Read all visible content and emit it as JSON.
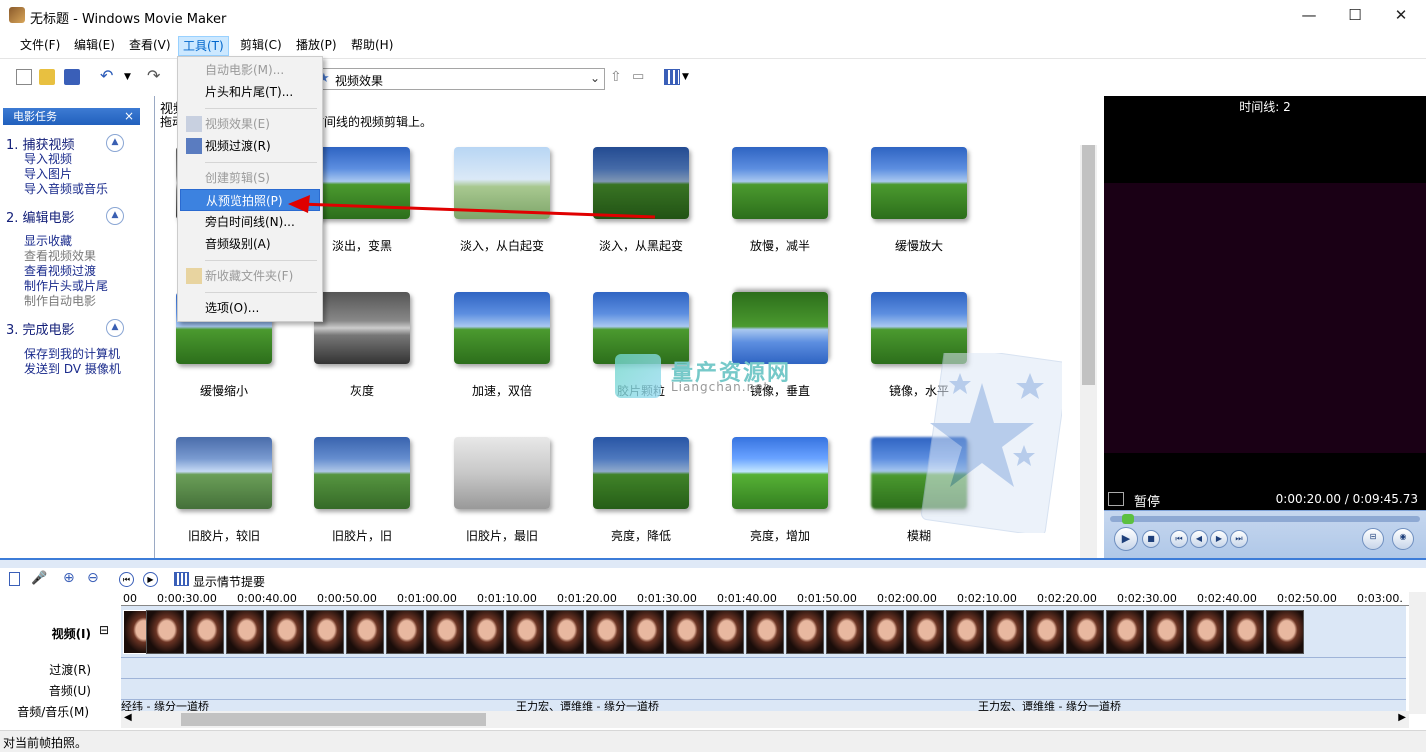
{
  "window": {
    "title": "无标题 - Windows Movie Maker",
    "minimize": "—",
    "maximize": "☐",
    "close": "✕"
  },
  "menu": [
    "文件(F)",
    "编辑(E)",
    "查看(V)",
    "工具(T)",
    "剪辑(C)",
    "播放(P)",
    "帮助(H)"
  ],
  "active_menu": "工具(T)",
  "toolbar": {
    "collection": "视频效果"
  },
  "tools_menu": {
    "items": [
      {
        "label": "自动电影(M)...",
        "enabled": false
      },
      {
        "label": "片头和片尾(T)...",
        "enabled": true
      },
      {
        "label": "视频效果(E)",
        "enabled": false
      },
      {
        "label": "视频过渡(R)",
        "enabled": true
      },
      {
        "label": "创建剪辑(S)",
        "enabled": false
      },
      {
        "label": "从预览拍照(P)",
        "enabled": true,
        "highlighted": true
      },
      {
        "label": "旁白时间线(N)...",
        "enabled": true
      },
      {
        "label": "音频级别(A)",
        "enabled": true
      },
      {
        "label": "新收藏文件夹(F)",
        "enabled": false
      },
      {
        "label": "选项(O)...",
        "enabled": true
      }
    ]
  },
  "taskpane": {
    "header": "电影任务",
    "close": "×",
    "toggle": "▲",
    "sections": [
      {
        "title": "1.  捕获视频",
        "links": [
          "导入视频",
          "导入图片",
          "导入音频或音乐"
        ],
        "disabled": []
      },
      {
        "title": "2.  编辑电影",
        "links": [
          "显示收藏",
          "查看视频效果",
          "查看视频过渡",
          "制作片头或片尾",
          "制作自动电影"
        ],
        "disabled": [
          1,
          4
        ]
      },
      {
        "title": "3.  完成电影",
        "links": [
          "保存到我的计算机",
          "发送到 DV 摄像机"
        ],
        "disabled": []
      }
    ]
  },
  "content": {
    "title": "视频",
    "desc_left": "拖动",
    "desc_right": "时间线的视频剪辑上。",
    "effects": [
      "淡出，变黑",
      "淡入，从白起变",
      "淡入，从黑起变",
      "放慢，减半",
      "缓慢放大",
      "缓慢缩小",
      "灰度",
      "加速，双倍",
      "胶片颗粒",
      "镜像，垂直",
      "镜像，水平",
      "旧胶片，较旧",
      "旧胶片，旧",
      "旧胶片，最旧",
      "亮度，降低",
      "亮度，增加",
      "模糊"
    ]
  },
  "watermark": {
    "title": "量产资源网",
    "sub": "Liangchan.net"
  },
  "preview": {
    "header": "时间线: 2",
    "status": "暂停",
    "time": "0:00:20.00 / 0:09:45.73"
  },
  "timeline": {
    "toolbar_label": "显示情节提要",
    "ticks": [
      "00",
      "0:00:30.00",
      "0:00:40.00",
      "0:00:50.00",
      "0:01:00.00",
      "0:01:10.00",
      "0:01:20.00",
      "0:01:30.00",
      "0:01:40.00",
      "0:01:50.00",
      "0:02:00.00",
      "0:02:10.00",
      "0:02:20.00",
      "0:02:30.00",
      "0:02:40.00",
      "0:02:50.00",
      "0:03:00."
    ],
    "tracks": {
      "video": "视频(I)",
      "transition": "过渡(R)",
      "audio": "音频(U)",
      "music": "音频/音乐(M)"
    },
    "music_clips": [
      "经纬 - 缘分一道桥",
      "王力宏、谭维维 - 缘分一道桥",
      "王力宏、谭维维 - 缘分一道桥"
    ],
    "collapse": "⊟"
  },
  "status": "对当前帧拍照。"
}
